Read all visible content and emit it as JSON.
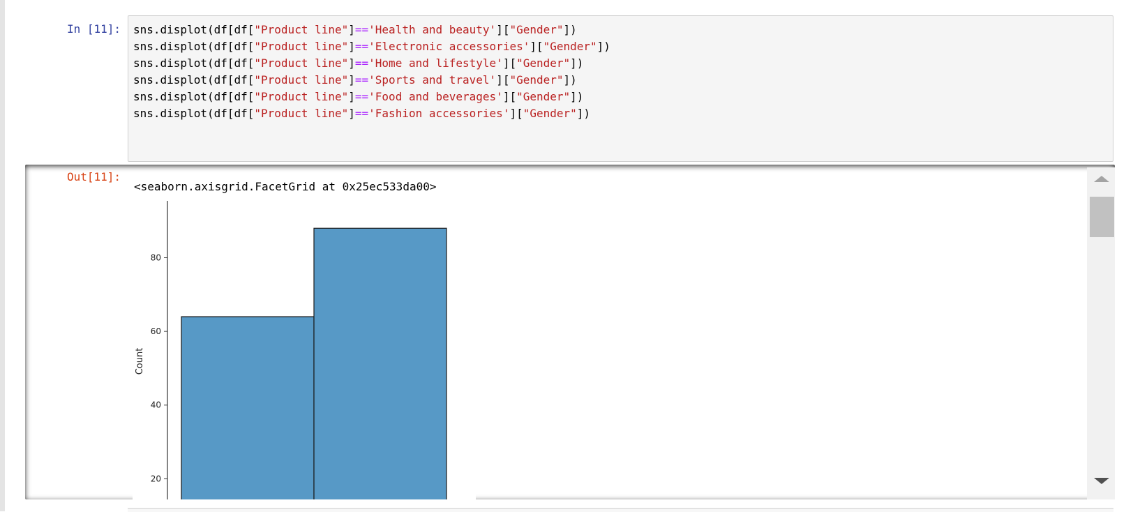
{
  "cell": {
    "in_prompt": "In [11]:",
    "out_prompt": "Out[11]:",
    "code_lines": [
      [
        {
          "t": "sns.displot(df[df["
        },
        {
          "t": "\"Product line\"",
          "k": "str"
        },
        {
          "t": "]"
        },
        {
          "t": "==",
          "k": "op"
        },
        {
          "t": "'Health and beauty'",
          "k": "str"
        },
        {
          "t": "]["
        },
        {
          "t": "\"Gender\"",
          "k": "str"
        },
        {
          "t": "])"
        }
      ],
      [
        {
          "t": "sns.displot(df[df["
        },
        {
          "t": "\"Product line\"",
          "k": "str"
        },
        {
          "t": "]"
        },
        {
          "t": "==",
          "k": "op"
        },
        {
          "t": "'Electronic accessories'",
          "k": "str"
        },
        {
          "t": "]["
        },
        {
          "t": "\"Gender\"",
          "k": "str"
        },
        {
          "t": "])"
        }
      ],
      [
        {
          "t": "sns.displot(df[df["
        },
        {
          "t": "\"Product line\"",
          "k": "str"
        },
        {
          "t": "]"
        },
        {
          "t": "==",
          "k": "op"
        },
        {
          "t": "'Home and lifestyle'",
          "k": "str"
        },
        {
          "t": "]["
        },
        {
          "t": "\"Gender\"",
          "k": "str"
        },
        {
          "t": "])"
        }
      ],
      [
        {
          "t": "sns.displot(df[df["
        },
        {
          "t": "\"Product line\"",
          "k": "str"
        },
        {
          "t": "]"
        },
        {
          "t": "==",
          "k": "op"
        },
        {
          "t": "'Sports and travel'",
          "k": "str"
        },
        {
          "t": "]["
        },
        {
          "t": "\"Gender\"",
          "k": "str"
        },
        {
          "t": "])"
        }
      ],
      [
        {
          "t": "sns.displot(df[df["
        },
        {
          "t": "\"Product line\"",
          "k": "str"
        },
        {
          "t": "]"
        },
        {
          "t": "==",
          "k": "op"
        },
        {
          "t": "'Food and beverages'",
          "k": "str"
        },
        {
          "t": "]["
        },
        {
          "t": "\"Gender\"",
          "k": "str"
        },
        {
          "t": "])"
        }
      ],
      [
        {
          "t": "sns.displot(df[df["
        },
        {
          "t": "\"Product line\"",
          "k": "str"
        },
        {
          "t": "]"
        },
        {
          "t": "==",
          "k": "op"
        },
        {
          "t": "'Fashion accessories'",
          "k": "str"
        },
        {
          "t": "]["
        },
        {
          "t": "\"Gender\"",
          "k": "str"
        },
        {
          "t": "])"
        }
      ]
    ],
    "output_text": "<seaborn.axisgrid.FacetGrid at 0x25ec533da00>"
  },
  "colors": {
    "in_prompt": "#303f9f",
    "out_prompt": "#d84315",
    "string": "#ba2121",
    "operator": "#aa22ff",
    "bar_fill": "#5799c6",
    "bar_edge": "#1a1a1a"
  },
  "chart_data": {
    "type": "bar",
    "categories": [
      "",
      ""
    ],
    "values": [
      64,
      88
    ],
    "title": "",
    "xlabel": "",
    "ylabel": "Count",
    "yticks": [
      20,
      40,
      60,
      80
    ],
    "ylim": [
      0,
      92.4
    ],
    "grid": false
  }
}
